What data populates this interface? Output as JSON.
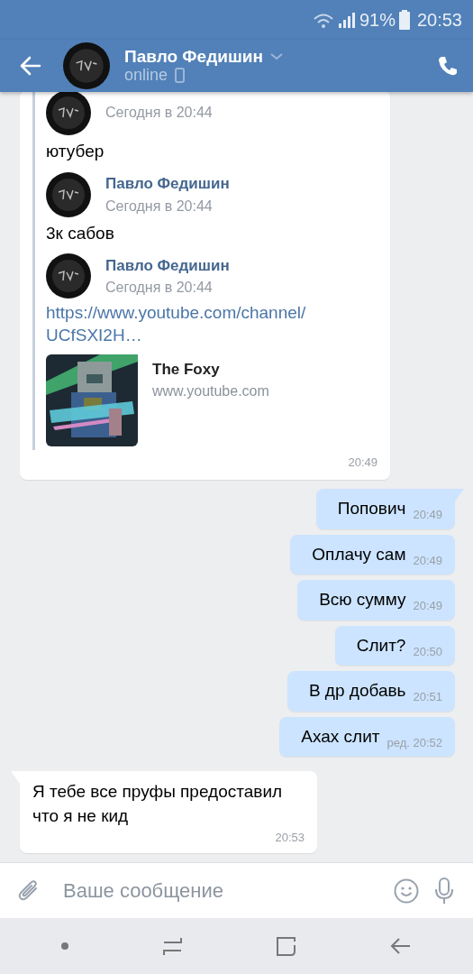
{
  "status_bar": {
    "battery": "91%",
    "time": "20:53"
  },
  "header": {
    "name": "Павло Федишин",
    "status": "online"
  },
  "messages": [
    {
      "kind": "forward",
      "forwarded": [
        {
          "time": "Сегодня в 20:44",
          "text": "ютубер"
        },
        {
          "name": "Павло Федишин",
          "time": "Сегодня в 20:44",
          "text": "3к сабов"
        },
        {
          "name": "Павло Федишин",
          "time": "Сегодня в 20:44",
          "link": "https://www.youtube.com/channel/UCfSXI2H…",
          "preview": {
            "title": "The Foxy",
            "domain": "www.youtube.com"
          }
        }
      ],
      "time": "20:49"
    },
    {
      "kind": "outgoing",
      "text": "Попович",
      "time": "20:49",
      "tail": true
    },
    {
      "kind": "outgoing",
      "text": "Оплачу сам",
      "time": "20:49",
      "tail": false
    },
    {
      "kind": "outgoing",
      "text": "Всю сумму",
      "time": "20:49",
      "tail": false
    },
    {
      "kind": "outgoing",
      "text": "Слит?",
      "time": "20:50",
      "tail": false
    },
    {
      "kind": "outgoing",
      "text": "В др добавь",
      "time": "20:51",
      "tail": false
    },
    {
      "kind": "outgoing",
      "text": "Ахах слит",
      "edited_label": "ред.",
      "time": "20:52",
      "tail": false
    },
    {
      "kind": "incoming",
      "text": "Я тебе все пруфы предоставил что я не кид",
      "time": "20:53",
      "tail": true
    }
  ],
  "composer": {
    "placeholder": "Ваше сообщение"
  }
}
